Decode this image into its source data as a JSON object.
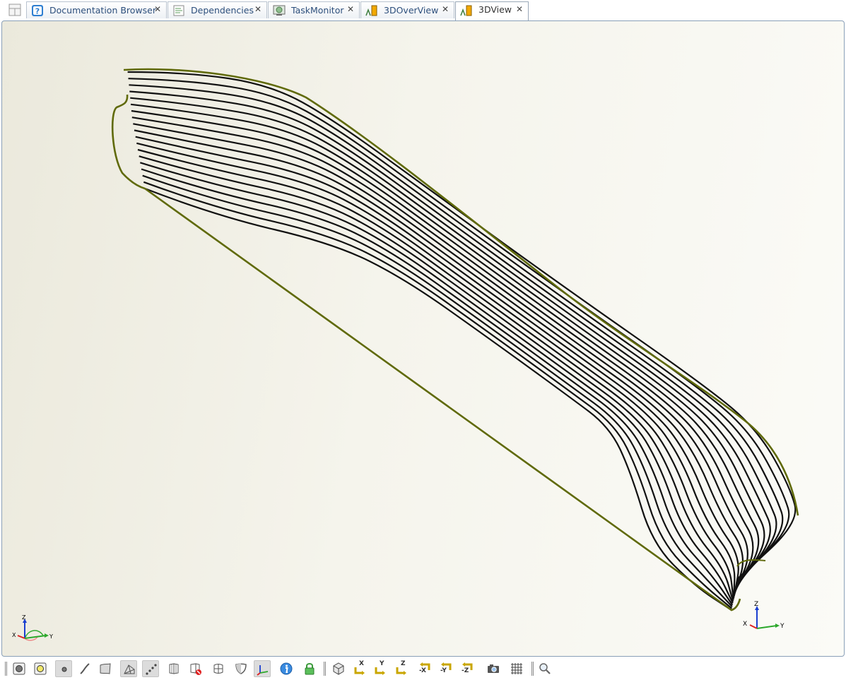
{
  "tabs": [
    {
      "label": "Documentation Browser",
      "icon": "help-icon",
      "active": false
    },
    {
      "label": "Dependencies",
      "icon": "document-icon",
      "active": false
    },
    {
      "label": "TaskMonitor",
      "icon": "monitor-icon",
      "active": false
    },
    {
      "label": "3DOverView",
      "icon": "bar-chart-icon",
      "active": false
    },
    {
      "label": "3DView",
      "icon": "bar-chart-icon",
      "active": true
    }
  ],
  "tab_close_glyph": "✕",
  "viewport": {
    "background_colors": [
      "#ebe9dc",
      "#fbfbf7"
    ],
    "outline_color": "#606a0a",
    "section_line_color": "#111111",
    "section_line_count": 19
  },
  "axis_triad_labels": {
    "x": "X",
    "y": "Y",
    "z": "Z"
  },
  "toolbar": {
    "buttons": [
      "render-points-icon",
      "render-nodes-icon",
      "point-size-icon",
      "curve-icon",
      "surface-icon",
      "wireframe-icon",
      "dotted-line-icon",
      "split-view-icon",
      "clip-delete-icon",
      "grid-surface-icon",
      "shield-icon",
      "axis-icon",
      "info-icon",
      "lock-icon",
      "cube-view-icon",
      "view-x-icon",
      "view-y-icon",
      "view-z-icon",
      "view-neg-x-icon",
      "view-neg-y-icon",
      "view-neg-z-icon",
      "camera-icon",
      "grid-icon",
      "zoom-icon"
    ],
    "view_labels": {
      "x": "X",
      "y": "Y",
      "z": "Z",
      "neg_x": "-X",
      "neg_y": "-Y",
      "neg_z": "-Z"
    }
  }
}
